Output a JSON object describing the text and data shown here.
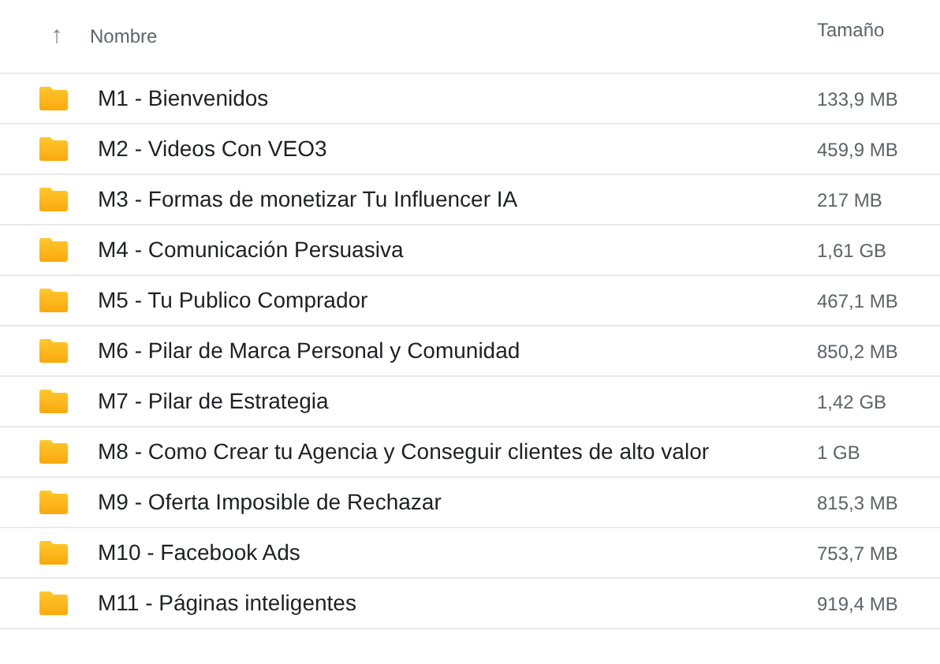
{
  "table": {
    "sort_icon": "↑",
    "columns": [
      "Nombre",
      "Tamaño"
    ],
    "rows": [
      {
        "name": "M1 - Bienvenidos",
        "size": "133,9 MB"
      },
      {
        "name": "M2 - Videos Con VEO3",
        "size": "459,9 MB"
      },
      {
        "name": "M3 - Formas de monetizar Tu Influencer IA",
        "size": "217 MB"
      },
      {
        "name": "M4 - Comunicación Persuasiva",
        "size": "1,61 GB"
      },
      {
        "name": "M5 - Tu Publico Comprador",
        "size": "467,1 MB"
      },
      {
        "name": "M6 - Pilar de Marca Personal y Comunidad",
        "size": "850,2 MB"
      },
      {
        "name": "M7 - Pilar de Estrategia",
        "size": "1,42 GB"
      },
      {
        "name": "M8 - Como Crear tu Agencia y Conseguir clientes de alto valor",
        "size": "1 GB"
      },
      {
        "name": "M9 - Oferta Imposible de Rechazar",
        "size": "815,3 MB"
      },
      {
        "name": "M10 - Facebook Ads",
        "size": "753,7 MB"
      },
      {
        "name": "M11 - Páginas inteligentes",
        "size": "919,4 MB"
      }
    ]
  }
}
